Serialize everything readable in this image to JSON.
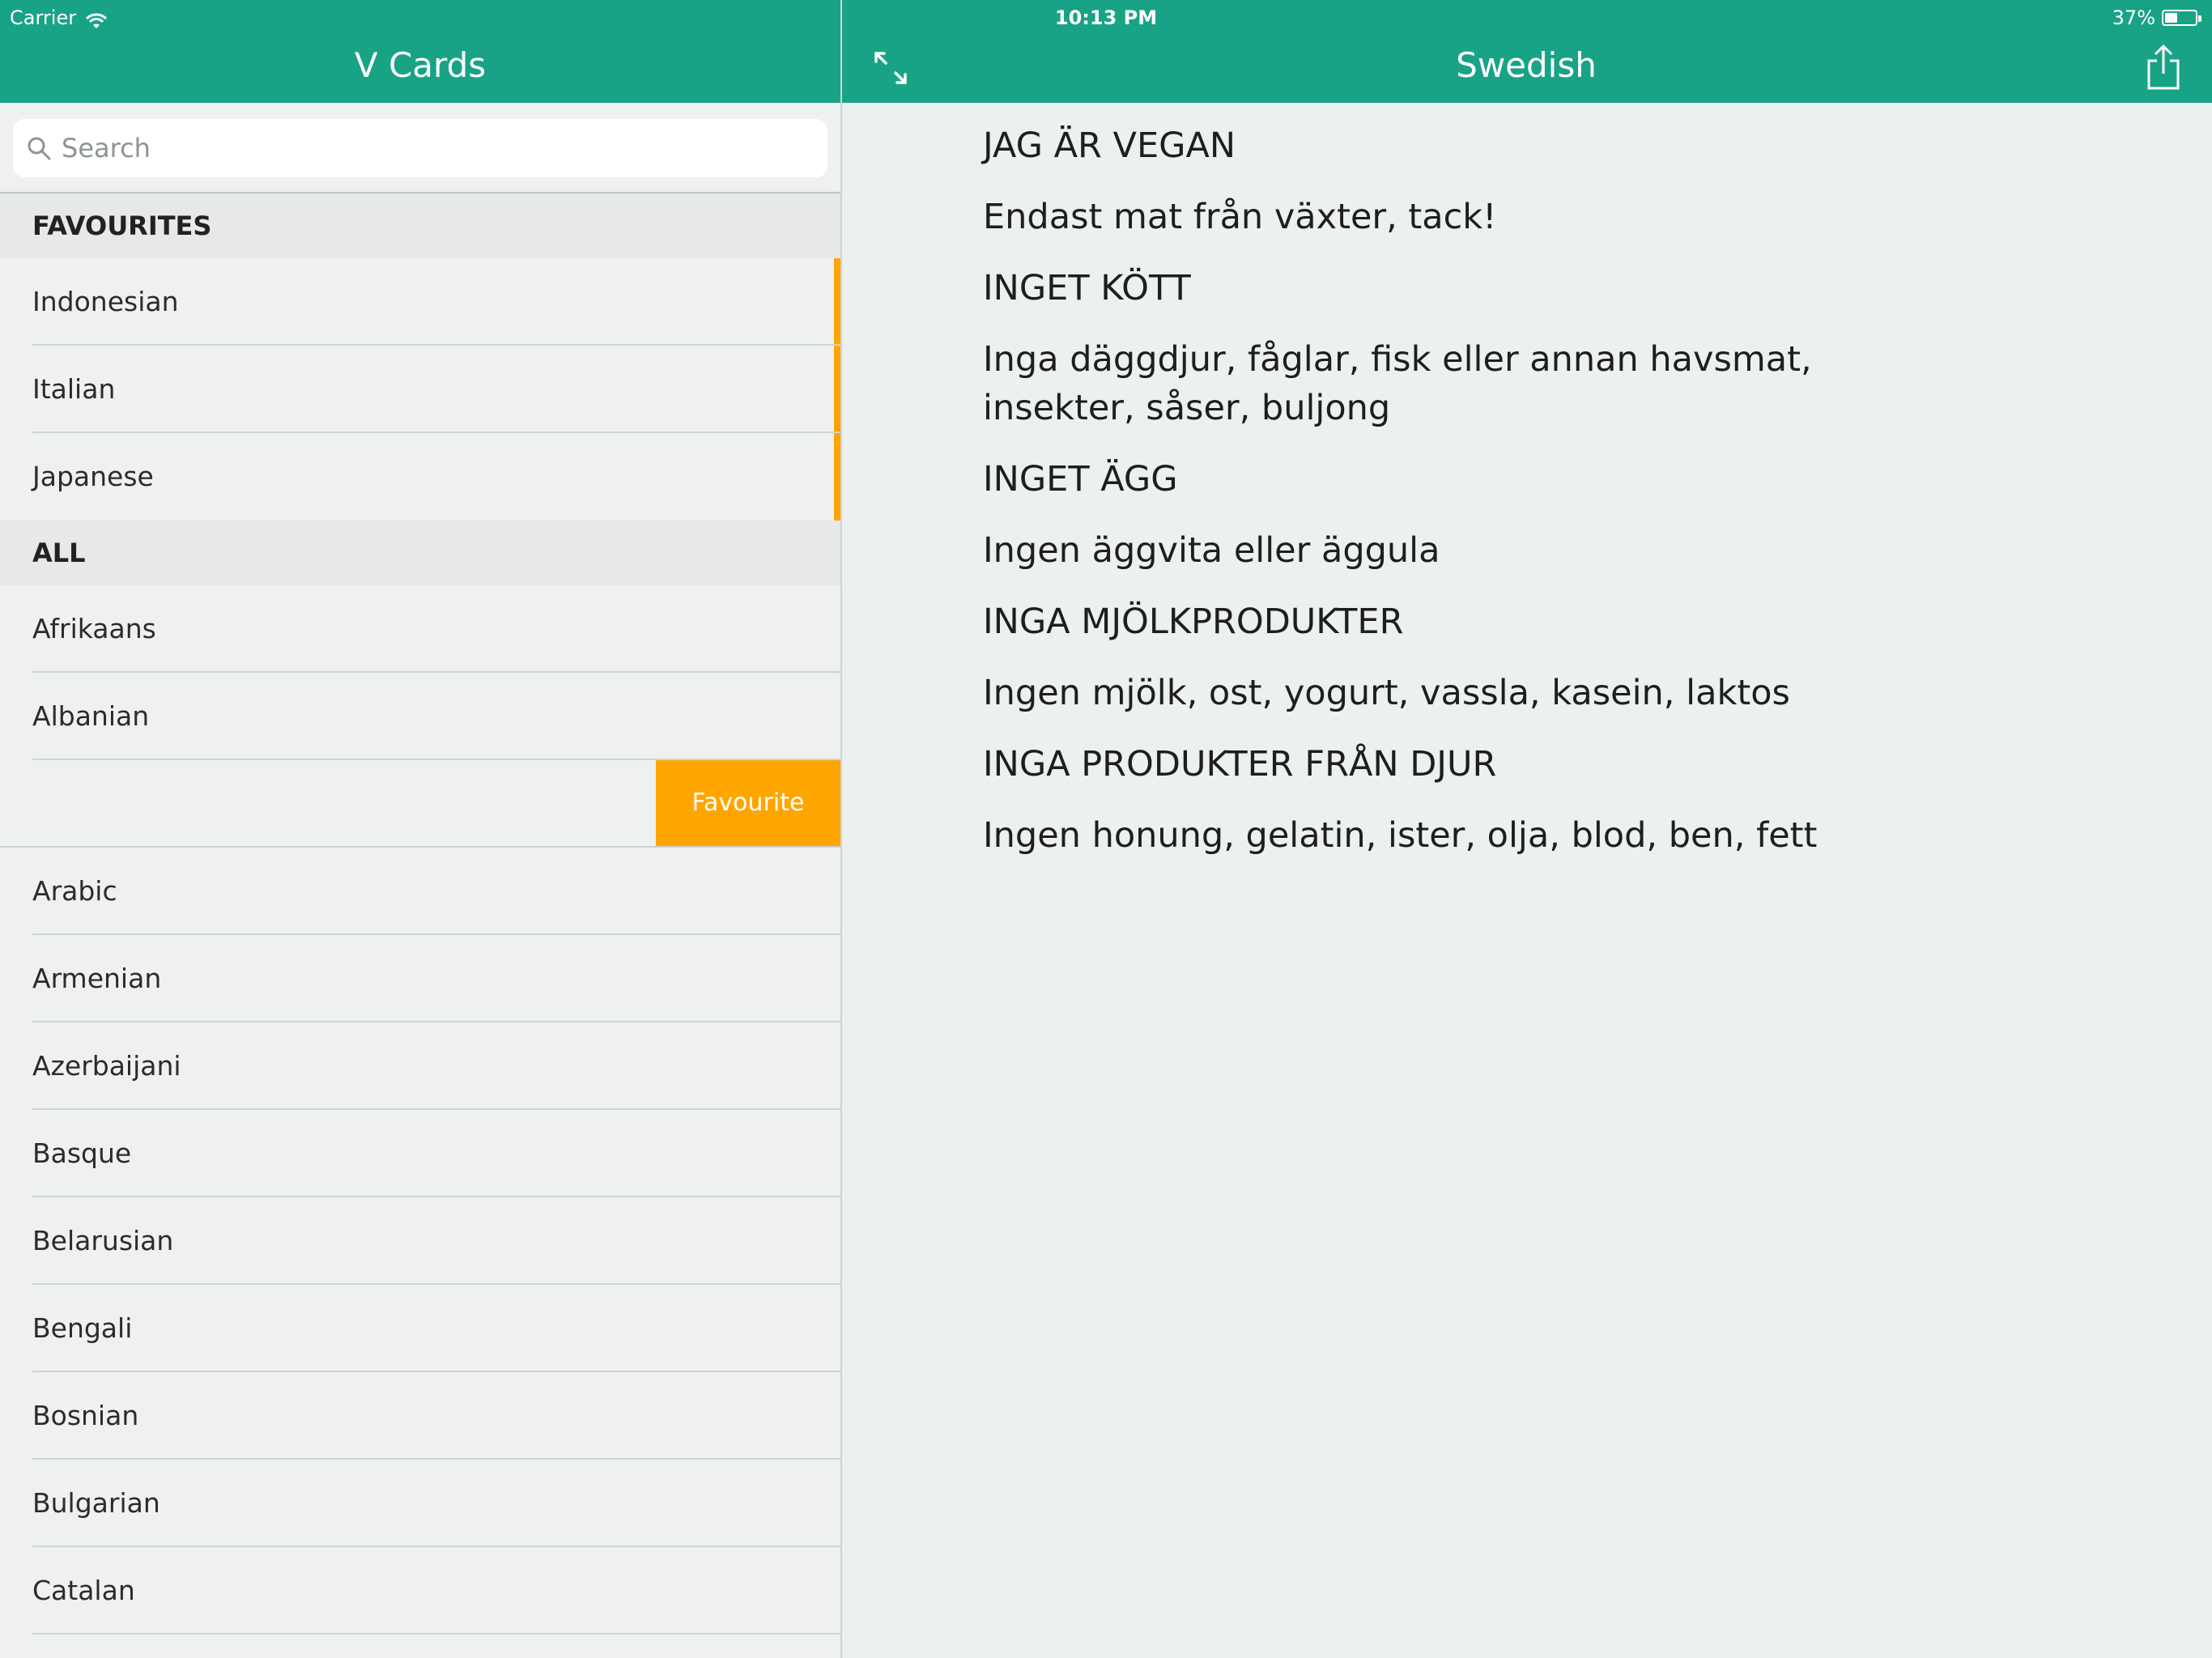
{
  "status_bar": {
    "carrier": "Carrier",
    "time": "10:13 PM",
    "battery": "37%"
  },
  "nav": {
    "left_title": "V Cards",
    "right_title": "Swedish"
  },
  "search": {
    "placeholder": "Search"
  },
  "sections": {
    "favourites": "FAVOURITES",
    "all": "ALL"
  },
  "favourites": [
    "Indonesian",
    "Italian",
    "Japanese"
  ],
  "all_items": [
    "Afrikaans",
    "Albanian",
    "",
    "Arabic",
    "Armenian",
    "Azerbaijani",
    "Basque",
    "Belarusian",
    "Bengali",
    "Bosnian",
    "Bulgarian",
    "Catalan"
  ],
  "swipe_action": {
    "label": "Favourite",
    "color": "#ffa500"
  },
  "content": {
    "lines": [
      {
        "kind": "heading",
        "text": "JAG ÄR VEGAN"
      },
      {
        "kind": "text",
        "text": "Endast mat från växter, tack!"
      },
      {
        "kind": "heading",
        "text": "INGET KÖTT"
      },
      {
        "kind": "text",
        "text": "Inga däggdjur, fåglar, fisk eller annan havsmat,  insekter, såser, buljong"
      },
      {
        "kind": "heading",
        "text": "INGET ÄGG"
      },
      {
        "kind": "text",
        "text": "Ingen äggvita eller äggula"
      },
      {
        "kind": "heading",
        "text": "INGA MJÖLKPRODUKTER"
      },
      {
        "kind": "text",
        "text": "Ingen mjölk, ost, yogurt, vassla, kasein, laktos"
      },
      {
        "kind": "heading",
        "text": "INGA PRODUKTER FRÅN DJUR"
      },
      {
        "kind": "text",
        "text": "Ingen honung, gelatin, ister, olja, blod, ben, fett"
      }
    ]
  },
  "colors": {
    "header": "#18a386",
    "accent": "#ffa500",
    "background": "#edf0f0"
  },
  "icons": {
    "wifi": "wifi-icon",
    "battery": "battery-icon",
    "expand": "expand-icon",
    "share": "share-icon",
    "search": "search-icon"
  }
}
